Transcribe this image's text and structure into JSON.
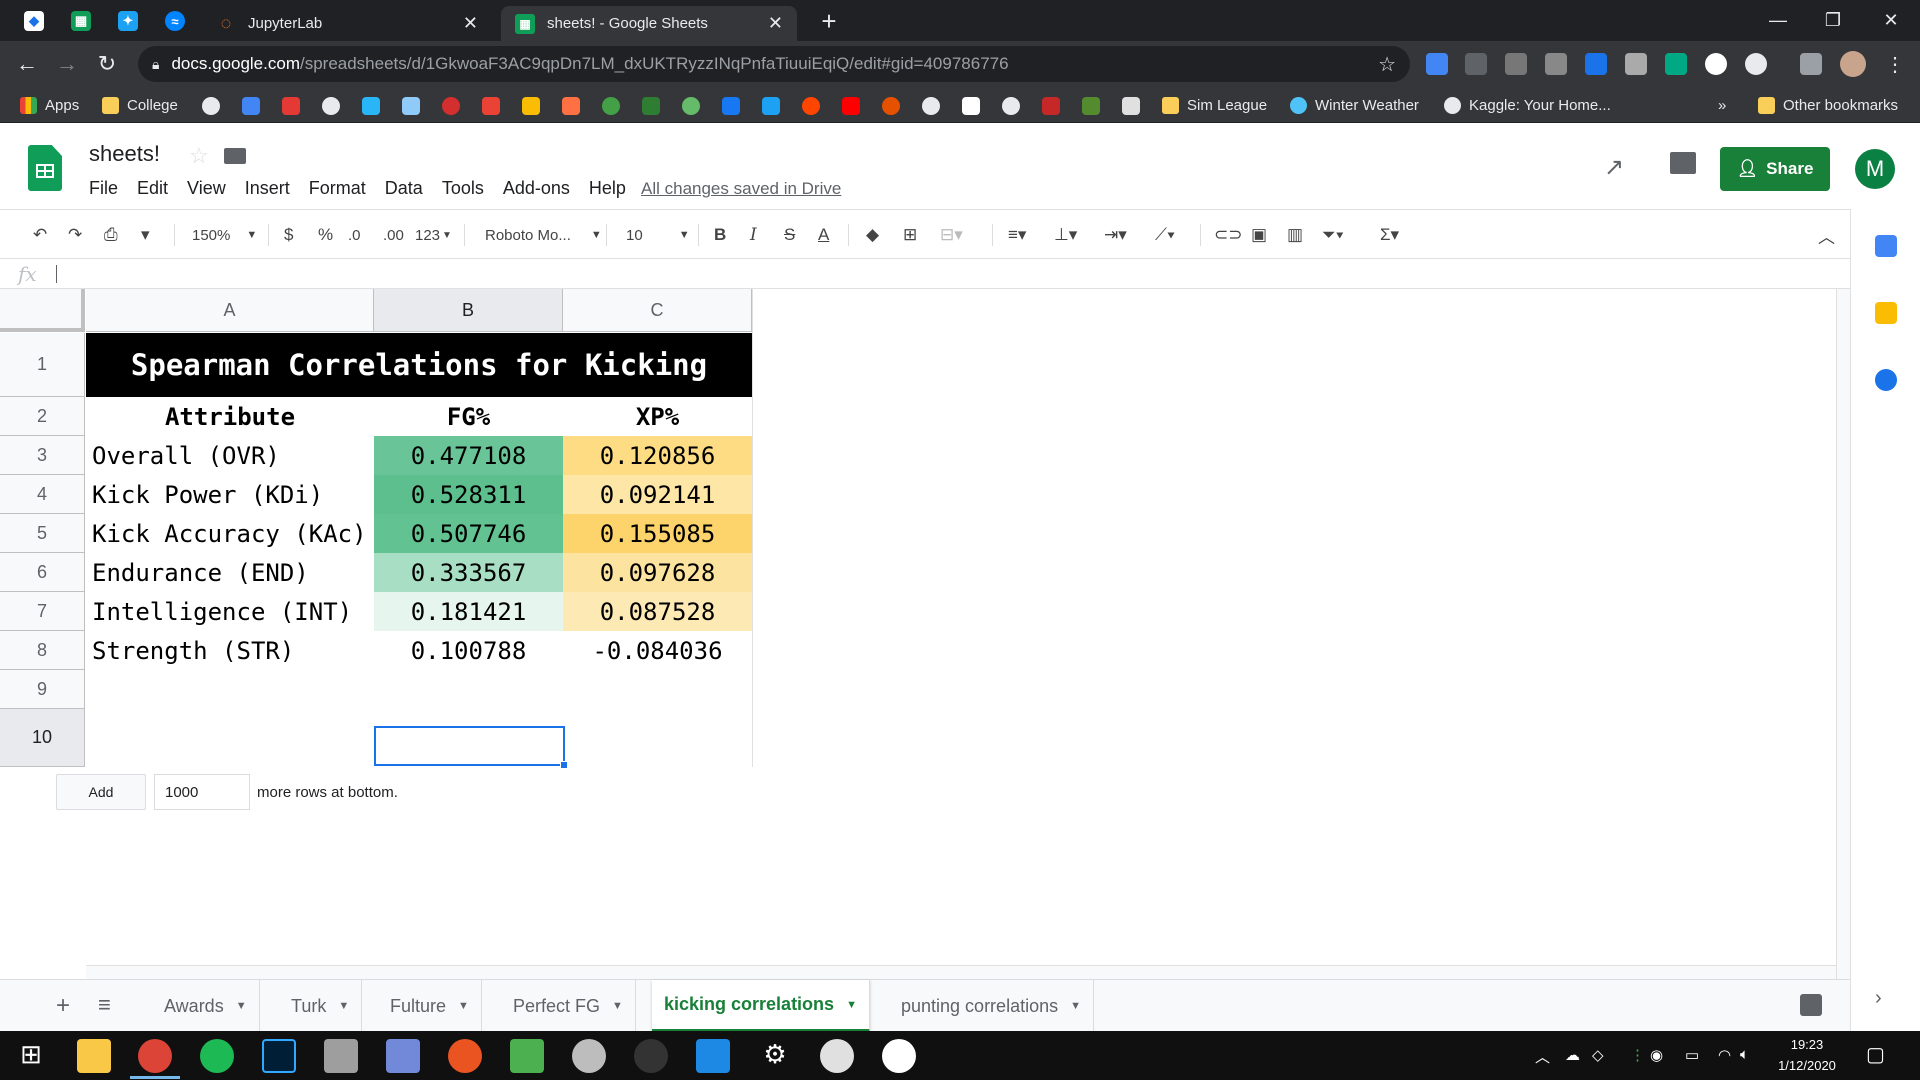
{
  "browser": {
    "tabs": [
      {
        "title": "JupyterLab"
      },
      {
        "title": "sheets! - Google Sheets"
      }
    ],
    "url_host": "docs.google.com",
    "url_path": "/spreadsheets/d/1GkwoaF3AC9qpDn7LM_dxUKTRyzzINqPnfaTiuuiEqiQ/edit#gid=409786776",
    "bookmarks": [
      "Apps",
      "College",
      "Sim League",
      "Winter Weather",
      "Kaggle: Your Home...",
      "Other bookmarks"
    ],
    "overflow": "»"
  },
  "sheets": {
    "title": "sheets!",
    "menu": [
      "File",
      "Edit",
      "View",
      "Insert",
      "Format",
      "Data",
      "Tools",
      "Add-ons",
      "Help"
    ],
    "saved_status": "All changes saved in Drive",
    "share_label": "Share",
    "avatar_letter": "M"
  },
  "toolbar": {
    "zoom": "150%",
    "currency": "$",
    "percent": "%",
    "dec_less": ".0",
    "dec_more": ".00",
    "format_more": "123",
    "font": "Roboto Mo...",
    "font_size": "10"
  },
  "formula_bar": {
    "fx": "fx"
  },
  "grid": {
    "columns": [
      "A",
      "B",
      "C"
    ],
    "rows": [
      "1",
      "2",
      "3",
      "4",
      "5",
      "6",
      "7",
      "8",
      "9",
      "10"
    ],
    "title": "Spearman Correlations for Kicking",
    "headers": [
      "Attribute",
      "FG%",
      "XP%"
    ],
    "data": [
      {
        "attr": "Overall (OVR)",
        "fg": "0.477108",
        "xp": "0.120856"
      },
      {
        "attr": "Kick Power (KDi)",
        "fg": "0.528311",
        "xp": "0.092141"
      },
      {
        "attr": "Kick Accuracy (KAc)",
        "fg": "0.507746",
        "xp": "0.155085"
      },
      {
        "attr": "Endurance (END)",
        "fg": "0.333567",
        "xp": "0.097628"
      },
      {
        "attr": "Intelligence (INT)",
        "fg": "0.181421",
        "xp": "0.087528"
      },
      {
        "attr": "Strength (STR)",
        "fg": "0.100788",
        "xp": "-0.084036"
      }
    ],
    "fg_colors": [
      "#69c597",
      "#5dbf8d",
      "#62c291",
      "#a8dfc4",
      "#e6f5ed",
      "#ffffff"
    ],
    "xp_colors": [
      "#fddc84",
      "#fde6a6",
      "#fdd46b",
      "#fde3a0",
      "#fde9b4",
      "#ffffff"
    ]
  },
  "add_rows": {
    "button": "Add",
    "count": "1000",
    "text": "more rows at bottom."
  },
  "sheet_tabs": [
    "Awards",
    "Turk",
    "Fulture",
    "Perfect FG",
    "kicking correlations",
    "punting correlations"
  ],
  "taskbar": {
    "time": "19:23",
    "date": "1/12/2020"
  }
}
